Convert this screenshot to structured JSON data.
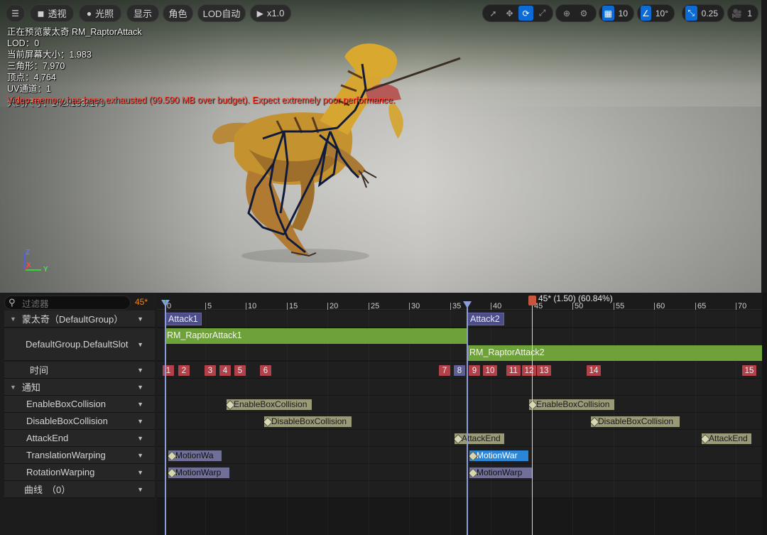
{
  "toolbar": {
    "menu_icon": "hamburger-menu-icon",
    "perspective_label": "透视",
    "lit_label": "光照",
    "show_label": "显示",
    "character_label": "角色",
    "lod_label": "LOD自动",
    "play_rate_label": "x1.0",
    "grid_snap_value": "10",
    "rotation_snap_value": "10°",
    "scale_snap_value": "0.25",
    "camera_speed_value": "1"
  },
  "viewport_info": {
    "lines": [
      "正在预览蒙太奇 RM_RaptorAttack",
      "LOD：0",
      "当前屏幕大小：1.983",
      "三角形：7,970",
      "顶点：4,764",
      "UV通道：1"
    ],
    "ghost_text": "大约尺寸：142x133x179",
    "warning": "Video memory has been exhausted (99.590 MB over budget). Expect extremely poor performance."
  },
  "axis": {
    "z": "Z",
    "x": "X",
    "y": "Y"
  },
  "filter": {
    "placeholder": "过滤器",
    "current_frame": "45*"
  },
  "tracks": {
    "montage_label": "蒙太奇（DefaultGroup）",
    "slot_label": "DefaultGroup.DefaultSlot",
    "time_label": "时间",
    "notify_label": "通知",
    "notify_tracks": [
      "EnableBoxCollision",
      "DisableBoxCollision",
      "AttackEnd",
      "TranslationWarping",
      "RotationWarping"
    ],
    "curve_label": "曲线",
    "curve_count": "（0）"
  },
  "timeline": {
    "ticks": [
      "0",
      "5",
      "10",
      "15",
      "20",
      "25",
      "30",
      "35",
      "40",
      "45",
      "50",
      "55",
      "60",
      "65",
      "70"
    ],
    "playhead_label": "45* (1.50) (60.84%)",
    "sections": [
      "Attack1",
      "Attack2"
    ],
    "segments": [
      "RM_RaptorAttack1",
      "RM_RaptorAttack2"
    ],
    "markers": [
      "1",
      "2",
      "3",
      "4",
      "5",
      "6",
      "7",
      "8",
      "9",
      "10",
      "11",
      "12",
      "13",
      "14",
      "15"
    ],
    "notifies": {
      "enable": [
        "EnableBoxCollision",
        "EnableBoxCollision"
      ],
      "disable": [
        "DisableBoxCollision",
        "DisableBoxCollision"
      ],
      "attack_end": [
        "AttackEnd",
        "AttackEnd"
      ],
      "translation": [
        "MotionWa",
        "MotionWar"
      ],
      "rotation": [
        "MotionWarp",
        "MotionWarp"
      ]
    }
  },
  "colors": {
    "section": "#4d4d8a",
    "segment": "#6fa13b",
    "marker": "#b3414a",
    "notify": "#9a9a78",
    "state_notify": "#6f6f98",
    "selected": "#2c86d8",
    "accent": "#0d6bd6"
  }
}
